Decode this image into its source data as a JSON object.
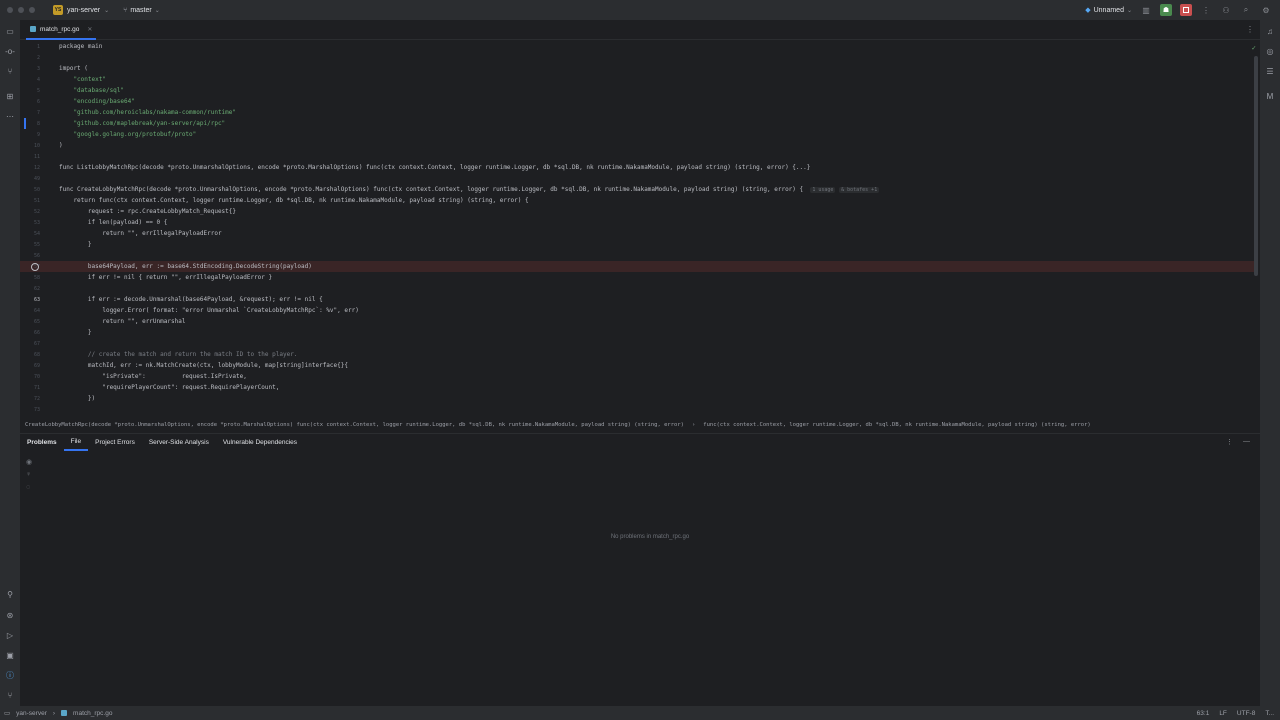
{
  "titlebar": {
    "project_badge": "YS",
    "project_name": "yan-server",
    "branch": "master",
    "run_config": "Unnamed"
  },
  "tabs": [
    {
      "label": "match_rpc.go"
    }
  ],
  "editor": {
    "lines": [
      {
        "n": "1",
        "text": "package main"
      },
      {
        "n": "2",
        "text": ""
      },
      {
        "n": "3",
        "text": "import ("
      },
      {
        "n": "4",
        "text": "    \"context\""
      },
      {
        "n": "5",
        "text": "    \"database/sql\""
      },
      {
        "n": "6",
        "text": "    \"encoding/base64\""
      },
      {
        "n": "7",
        "text": "    \"github.com/heroiclabs/nakama-common/runtime\""
      },
      {
        "n": "8",
        "text": "    \"github.com/maplebreak/yan-server/api/rpc\""
      },
      {
        "n": "9",
        "text": "    \"google.golang.org/protobuf/proto\""
      },
      {
        "n": "10",
        "text": ")"
      },
      {
        "n": "11",
        "text": ""
      },
      {
        "n": "12",
        "text": "func ListLobbyMatchRpc(decode *proto.UnmarshalOptions, encode *proto.MarshalOptions) func(ctx context.Context, logger runtime.Logger, db *sql.DB, nk runtime.NakamaModule, payload string) (string, error) {...}"
      },
      {
        "n": "49",
        "text": ""
      },
      {
        "n": "50",
        "text": "func CreateLobbyMatchRpc(decode *proto.UnmarshalOptions, encode *proto.MarshalOptions) func(ctx context.Context, logger runtime.Logger, db *sql.DB, nk runtime.NakamaModule, payload string) (string, error) {"
      },
      {
        "n": "51",
        "text": "    return func(ctx context.Context, logger runtime.Logger, db *sql.DB, nk runtime.NakamaModule, payload string) (string, error) {"
      },
      {
        "n": "52",
        "text": "        request := rpc.CreateLobbyMatch_Request{}"
      },
      {
        "n": "53",
        "text": "        if len(payload) == 0 {"
      },
      {
        "n": "54",
        "text": "            return \"\", errIllegalPayloadError"
      },
      {
        "n": "55",
        "text": "        }"
      },
      {
        "n": "56",
        "text": ""
      },
      {
        "n": "57",
        "text": "        base64Payload, err := base64.StdEncoding.DecodeString(payload)"
      },
      {
        "n": "58",
        "text": "        if err != nil { return \"\", errIllegalPayloadError }"
      },
      {
        "n": "62",
        "text": ""
      },
      {
        "n": "63",
        "text": "        if err := decode.Unmarshal(base64Payload, &request); err != nil {"
      },
      {
        "n": "64",
        "text": "            logger.Error( format: \"error Unmarshal `CreateLobbyMatchRpc`: %v\", err)"
      },
      {
        "n": "65",
        "text": "            return \"\", errUnmarshal"
      },
      {
        "n": "66",
        "text": "        }"
      },
      {
        "n": "67",
        "text": ""
      },
      {
        "n": "68",
        "text": "        // create the match and return the match ID to the player."
      },
      {
        "n": "69",
        "text": "        matchId, err := nk.MatchCreate(ctx, lobbyModule, map[string]interface{}{"
      },
      {
        "n": "70",
        "text": "            \"isPrivate\":          request.IsPrivate,"
      },
      {
        "n": "71",
        "text": "            \"requirePlayerCount\": request.RequirePlayerCount,"
      },
      {
        "n": "72",
        "text": "        })"
      },
      {
        "n": "73",
        "text": ""
      }
    ],
    "inlay_usage": "1 usage",
    "inlay_authors": "& botafes +1"
  },
  "breadcrumb": {
    "first": "CreateLobbyMatchRpc(decode *proto.UnmarshalOptions, encode *proto.MarshalOptions) func(ctx context.Context, logger runtime.Logger, db *sql.DB, nk runtime.NakamaModule, payload string) (string, error)",
    "second": "func(ctx context.Context, logger runtime.Logger, db *sql.DB, nk runtime.NakamaModule, payload string) (string, error)"
  },
  "panel": {
    "tabs": [
      "Problems",
      "File",
      "Project Errors",
      "Server-Side Analysis",
      "Vulnerable Dependencies"
    ],
    "active_tab": "File",
    "empty_message": "No problems in match_rpc.go"
  },
  "statusbar": {
    "project": "yan-server",
    "file": "match_rpc.go",
    "position": "63:1",
    "line_ending": "LF",
    "encoding": "UTF-8",
    "extra": "T..."
  }
}
